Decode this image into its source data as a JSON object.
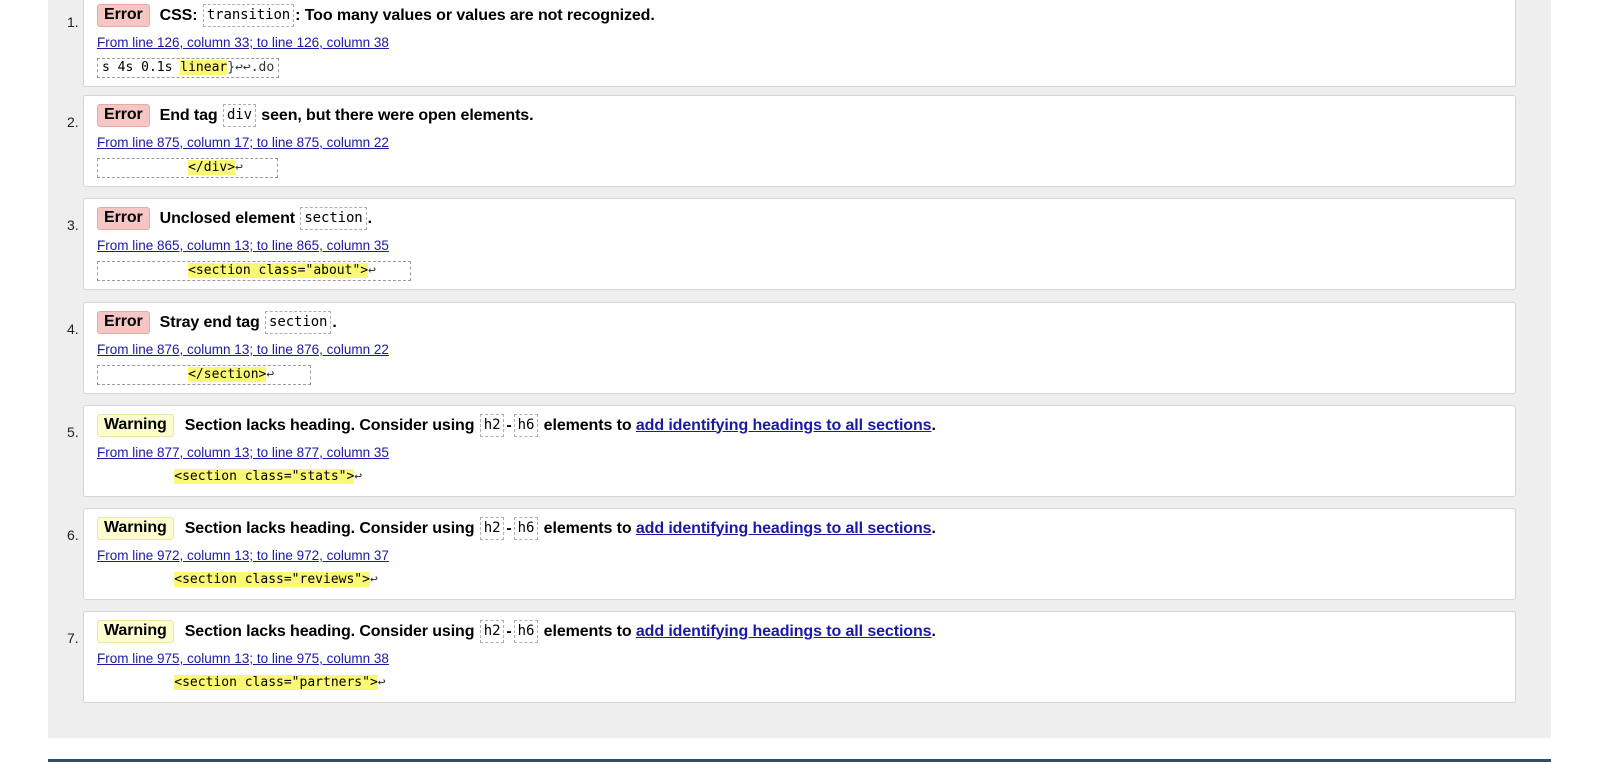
{
  "colors": {
    "error_badge_bg": "#f5c6c3",
    "warning_badge_bg": "#fdfccf",
    "highlight": "#fbf875",
    "link": "#1a1aa6",
    "panel_bg": "#eeeeee"
  },
  "messages": [
    {
      "number": "1.",
      "type": "Error",
      "text_parts": [
        "CSS: ",
        "transition",
        ": Too many values or values are not recognized."
      ],
      "location": "From line 126, column 33; to line 126, column 38",
      "extract": {
        "pre": "s 4s 0.1s ",
        "highlight": "linear",
        "post": "}↩↩.do"
      }
    },
    {
      "number": "2.",
      "type": "Error",
      "text_parts": [
        "End tag ",
        "div",
        " seen, but there were open elements."
      ],
      "location": "From line 875, column 17; to line 875, column 22",
      "extract": {
        "pre": "           ",
        "highlight": "</div>",
        "post": "↩"
      }
    },
    {
      "number": "3.",
      "type": "Error",
      "text_parts": [
        "Unclosed element ",
        "section",
        "."
      ],
      "location": "From line 865, column 13; to line 865, column 35",
      "extract": {
        "pre": "           ",
        "highlight": "<section class=\"about\">",
        "post": "↩"
      }
    },
    {
      "number": "4.",
      "type": "Error",
      "text_parts": [
        "Stray end tag ",
        "section",
        "."
      ],
      "location": "From line 876, column 13; to line 876, column 22",
      "extract": {
        "pre": "           ",
        "highlight": "</section>",
        "post": "↩"
      }
    },
    {
      "number": "5.",
      "type": "Warning",
      "text_parts": [
        "Section lacks heading. Consider using ",
        "h2",
        "-",
        "h6",
        " elements to ",
        "add identifying headings to all sections",
        "."
      ],
      "location": "From line 877, column 13; to line 877, column 35",
      "extract": {
        "pre": "          ",
        "highlight": "<section class=\"stats\">",
        "post": "↩"
      }
    },
    {
      "number": "6.",
      "type": "Warning",
      "text_parts": [
        "Section lacks heading. Consider using ",
        "h2",
        "-",
        "h6",
        " elements to ",
        "add identifying headings to all sections",
        "."
      ],
      "location": "From line 972, column 13; to line 972, column 37",
      "extract": {
        "pre": "          ",
        "highlight": "<section class=\"reviews\">",
        "post": "↩"
      }
    },
    {
      "number": "7.",
      "type": "Warning",
      "text_parts": [
        "Section lacks heading. Consider using ",
        "h2",
        "-",
        "h6",
        " elements to ",
        "add identifying headings to all sections",
        "."
      ],
      "location": "From line 975, column 13; to line 975, column 38",
      "extract": {
        "pre": "          ",
        "highlight": "<section class=\"partners\">",
        "post": "↩"
      }
    }
  ]
}
